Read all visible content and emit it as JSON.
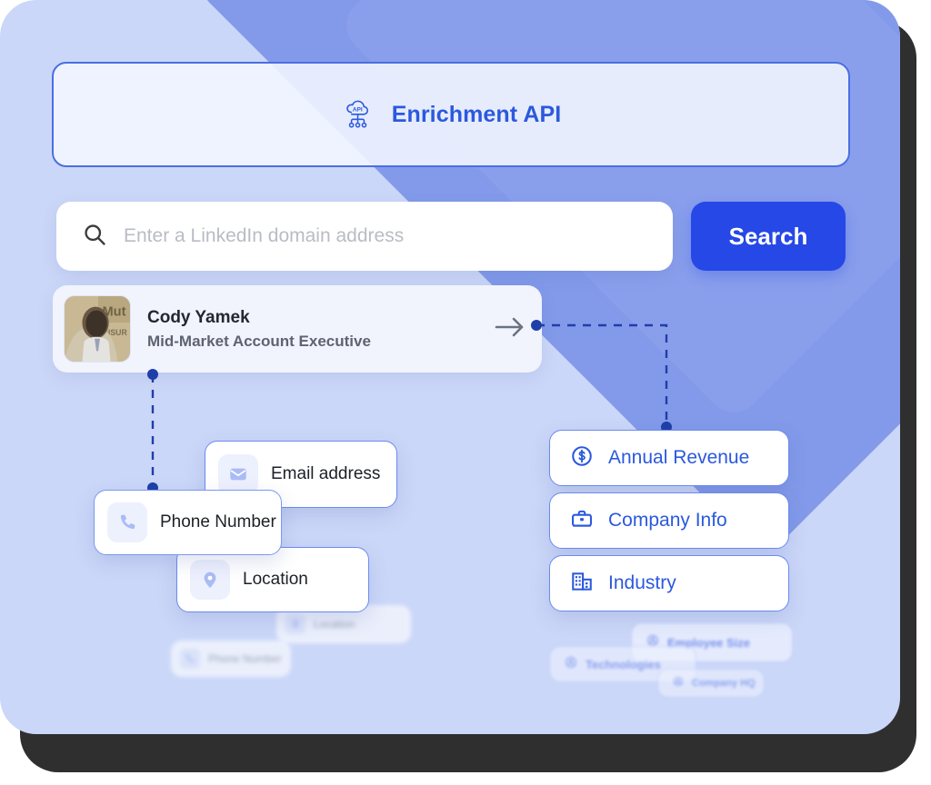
{
  "header": {
    "title": "Enrichment API",
    "icon": "cloud-api-icon"
  },
  "search": {
    "placeholder": "Enter a LinkedIn domain address",
    "value": "",
    "button_label": "Search",
    "icon": "search-icon"
  },
  "profile": {
    "name": "Cody Yamek",
    "role": "Mid-Market Account Executive",
    "avatar": "profile-photo",
    "arrow": "arrow-right-icon"
  },
  "person_fields": [
    {
      "label": "Email address",
      "icon": "envelope-icon"
    },
    {
      "label": "Phone Number",
      "icon": "phone-icon"
    },
    {
      "label": "Location",
      "icon": "map-pin-icon"
    }
  ],
  "company_fields": [
    {
      "label": "Annual Revenue",
      "icon": "dollar-circle-icon"
    },
    {
      "label": "Company Info",
      "icon": "briefcase-icon"
    },
    {
      "label": "Industry",
      "icon": "building-icon"
    }
  ],
  "background_fields_left": [
    {
      "label": "Location",
      "icon": "map-pin-icon"
    },
    {
      "label": "Phone Number",
      "icon": "phone-icon"
    }
  ],
  "background_fields_right": [
    {
      "label": "Employee Size",
      "icon": "people-icon"
    },
    {
      "label": "Technologies",
      "icon": "people-icon"
    },
    {
      "label": "Company HQ",
      "icon": "people-icon"
    }
  ],
  "colors": {
    "panel_bg": "#CBD7F8",
    "accent_blue": "#2548E6",
    "title_blue": "#2B59DD",
    "card_border": "#6B8BEF",
    "decor_blue": "#7D95E8",
    "frame_dark": "#2F2F2F",
    "icon_tile": "#EDF0FD"
  }
}
